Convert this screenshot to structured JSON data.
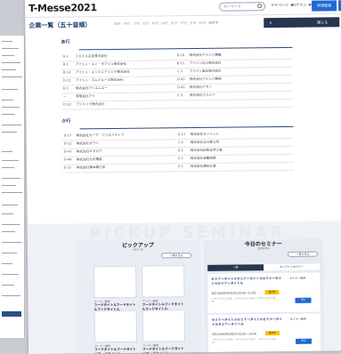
{
  "header": {
    "logo": "T-Messe2021",
    "search_placeholder": "キーワード",
    "nav": [
      "マイページ",
      "ログイン",
      "出展のご案内"
    ],
    "register_label": "新規登録"
  },
  "title": {
    "page_title": "企業一覧（五十音順）",
    "kana_index": [
      "あ行",
      "か行",
      "さ行",
      "た行",
      "な行",
      "は行",
      "ま行",
      "や行",
      "ら行",
      "わ行",
      "英数字"
    ],
    "close_label": "閉じる"
  },
  "groups": [
    {
      "label": "あ行",
      "rows": [
        [
          {
            "code": "A-3",
            "name": "ＩＤＥＡ広告株式会社"
          },
          {
            "code": "B-16",
            "name": "株式会社アイシン精機"
          }
        ],
        [
          {
            "code": "B-1",
            "name": "アイシン・エィ・ダブリュ株式会社"
          },
          {
            "code": "B-11",
            "name": "アイシン化工株式会社"
          }
        ],
        [
          {
            "code": "B-14",
            "name": "アイシン・エンジニアリング株式会社"
          },
          {
            "code": "C-3",
            "name": "アイシン高丘株式会社"
          }
        ],
        [
          {
            "code": "D-11",
            "name": "アイシン・コムクルーズ株式会社"
          },
          {
            "code": "D-43",
            "name": "株式会社アイシン開発"
          }
        ],
        [
          {
            "code": "E-1",
            "name": "株式会社アイエムエー"
          },
          {
            "code": "D-42",
            "name": "株式会社アサノ"
          }
        ],
        [
          {
            "code": "—",
            "name": "有限会社アベ"
          },
          {
            "code": "E-3",
            "name": "株式会社アルファ"
          }
        ],
        [
          {
            "code": "D-22",
            "name": "アンドック株式会社"
          },
          {
            "code": "",
            "name": ""
          }
        ]
      ]
    },
    {
      "label": "か行",
      "rows": [
        [
          {
            "code": "D-17",
            "name": "株式会社カーマ・クリエイティブ"
          },
          {
            "code": "D-15",
            "name": "株式会社カーペット"
          }
        ],
        [
          {
            "code": "D-12",
            "name": "株式会社カワイ"
          },
          {
            "code": "C-4",
            "name": "株式会社北川鉄工所"
          }
        ],
        [
          {
            "code": "D-43",
            "name": "株式会社キタガワ"
          },
          {
            "code": "E-2",
            "name": "株式会社紀和化学工業"
          }
        ],
        [
          {
            "code": "D-44",
            "name": "株式会社九州電設"
          },
          {
            "code": "E-5",
            "name": "株式会社倉敷紡績"
          }
        ],
        [
          {
            "code": "E-15",
            "name": "株式会社栗本鐵工所"
          },
          {
            "code": "E-5",
            "name": "株式会社栗田工業"
          }
        ]
      ]
    }
  ],
  "background_text": "PICKUP  SEMINAR",
  "pickup": {
    "title": "ピックアップ",
    "subtitle": "PICK UP",
    "more_label": "一覧を見る",
    "cards": [
      {
        "category": "フード・飲料",
        "title": "フードタイトルフードタイトルフードタイトル",
        "desc": "テキストが入ります。テキストが入ります。テキストが入ります。テキストが入ります。"
      },
      {
        "category": "フード・飲料",
        "title": "フードタイトルフードタイトルフードタイトル",
        "desc": "テキストが入ります。テキストが入ります。テキストが入ります。テキストが入ります。"
      },
      {
        "category": "フード・飲料",
        "title": "フードタイトルフードタイトルフードタイトル",
        "desc": "テキストが入ります。テキストが入ります。テキストが入ります。テキストが入ります。"
      },
      {
        "category": "フード・飲料",
        "title": "フードタイトルフードタイトルフードタイトル",
        "desc": "テキストが入ります。テキストが入ります。テキストが入ります。テキストが入ります。"
      }
    ]
  },
  "seminar": {
    "title": "今日のセミナー",
    "subtitle": "SEMINAR",
    "more_label": "一覧を見る",
    "tabs": [
      "一般",
      "オンラインセミナー"
    ],
    "items": [
      {
        "title": "セミナータイトルセミナータイトルセミナータイトルセミナータイトル",
        "org": "セミナー提供",
        "date": "2021年09月02日(木)10:00〜11:00",
        "tag": "受付中",
        "note": "テキストが入ります。テキストが入ります。テキストが入ります。",
        "apply": "申込",
        "meta1": "講演者名",
        "meta2": "会社名",
        "meta3": "肩書"
      },
      {
        "title": "セミナータイトルセミナータイトルセミナータイトルセミナータイトル",
        "org": "セミナー提供",
        "date": "2021年09月02日(木)13:00〜14:00",
        "tag": "受付中",
        "note": "テキストが入ります。テキストが入ります。テキストが入ります。",
        "apply": "申込",
        "meta1": "講演者名",
        "meta2": "会社名",
        "meta3": "肩書"
      }
    ]
  }
}
